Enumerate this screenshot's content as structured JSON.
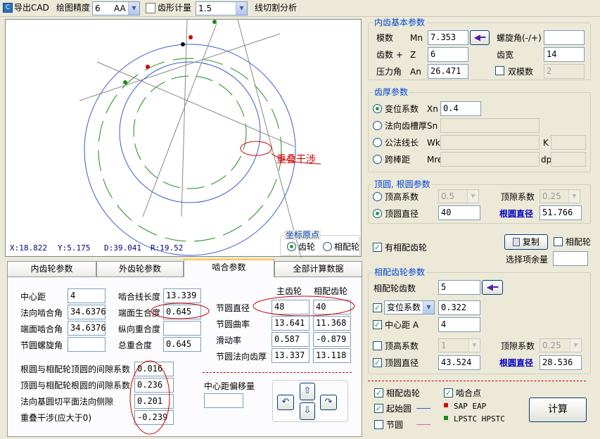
{
  "toolbar": {
    "export_cad": "导出CAD",
    "precision_label": "绘图精度",
    "precision_value": "6",
    "precision_unit": "AA",
    "tooth_measure": "齿形计量",
    "tooth_measure_value": "1.5",
    "wire_cut": "线切割分析"
  },
  "canvas": {
    "interference_label": "重叠干涉",
    "status_x": "X:18.822",
    "status_y": "Y:5.175",
    "status_d": "D:39.041",
    "status_r": "R:19.52",
    "origin_title": "坐标原点",
    "origin_gear": "齿轮",
    "origin_mating": "相配轮"
  },
  "tabs": [
    "内齿轮参数",
    "外齿轮参数",
    "啮合参数",
    "全部计算数据"
  ],
  "mesh": {
    "center_distance_label": "中心距",
    "center_distance": "4",
    "normal_mesh_angle_label": "法向啮合角",
    "normal_mesh_angle": "34.6376",
    "face_mesh_angle_label": "端面啮合角",
    "face_mesh_angle": "34.6376",
    "pitch_helix_label": "节圆螺旋角",
    "pitch_helix": "",
    "mesh_line_label": "啮合线长度",
    "mesh_line": "13.339",
    "face_overlap_label": "端面生合度",
    "face_overlap": "0.645",
    "axial_overlap_label": "纵向重合度",
    "axial_overlap": "",
    "total_overlap_label": "总重合度",
    "total_overlap": "0.645",
    "main_gear": "主齿轮",
    "mating_gear": "相配齿轮",
    "pitch_dia_label": "节圆直径",
    "pitch_dia": [
      "48",
      "40"
    ],
    "pitch_curv_label": "节圆曲率",
    "pitch_curv": [
      "13.641",
      "11.368"
    ],
    "slide_rate_label": "滑动率",
    "slide_rate": [
      "0.587",
      "-0.879"
    ],
    "pitch_thick_label": "节圆法向齿厚",
    "pitch_thick": [
      "13.337",
      "13.118"
    ],
    "clearance_root_label": "根圆与相配轮顶圆的间隙系数",
    "clearance_root": "0.016",
    "clearance_tip_label": "顶圆与相配轮根圆的间隙系数",
    "clearance_tip": "0.236",
    "backlash_label": "法向基圆切平面法向侧隙",
    "backlash": "0.201",
    "interference_label": "重叠干涉(应大于0)",
    "interference": "-0.239",
    "offset_label": "中心距偏移量",
    "offset": ""
  },
  "inner_basic": {
    "title": "内齿基本参数",
    "module_label": "模数",
    "module_sym": "Mn",
    "module": "7.353",
    "helix_label": "螺旋角(-/+)",
    "helix": "",
    "teeth_label": "齿数 +",
    "teeth_sym": "Z",
    "teeth": "6",
    "width_label": "齿宽",
    "width": "14",
    "pressure_label": "压力角",
    "pressure_sym": "An",
    "pressure": "26.471",
    "double_label": "双模数",
    "double_value": "2"
  },
  "thickness": {
    "title": "齿厚参数",
    "shift_label": "变位系数",
    "shift_sym": "Xn",
    "shift": "0.4",
    "slot_label": "法向齿槽厚",
    "slot_sym": "Sn",
    "span_label": "公法线长",
    "span_sym": "Wk",
    "k_label": "K",
    "pin_label": "跨棒距",
    "pin_sym": "Mre",
    "dp_label": "dp"
  },
  "tip_root": {
    "title": "顶圆, 根圆参数",
    "addendum_label": "顶高系数",
    "addendum_value": "0.5",
    "clearance_label": "顶隙系数",
    "clearance_value": "0.25",
    "tip_dia_label": "顶圆直径",
    "tip_dia": "40",
    "root_dia_label": "根圆直径",
    "root_dia": "51.766"
  },
  "mating": {
    "has_mating_label": "有相配齿轮",
    "copy_label": "复制",
    "mating_check": "相配轮",
    "margin_label": "选择项余量",
    "margin": "",
    "title": "相配齿轮参数",
    "teeth_label": "相配轮齿数",
    "teeth": "5",
    "shift_label": "变位系数",
    "shift": "0.322",
    "center_label": "中心距 A",
    "center": "4",
    "addendum_label": "顶高系数",
    "addendum_value": "1",
    "clearance_label": "顶隙系数",
    "clearance_value": "0.25",
    "tip_label": "顶圆直径",
    "tip": "43.524",
    "root_label": "根圆直径",
    "root": "28.536"
  },
  "display": {
    "mating_gear": "相配齿轮",
    "start_circle": "起始圆",
    "pitch_circle": "节圆",
    "mesh_point": "啮合点",
    "sap_eap": "SAP EAP",
    "lpstc": "LPSTC HPSTC",
    "calc_button": "计算"
  },
  "colors": {
    "accent_title": "#0046d5",
    "annotation_red": "#d00000",
    "gear_green": "#1a8a1a",
    "circle_blue": "#3a5ad0"
  }
}
